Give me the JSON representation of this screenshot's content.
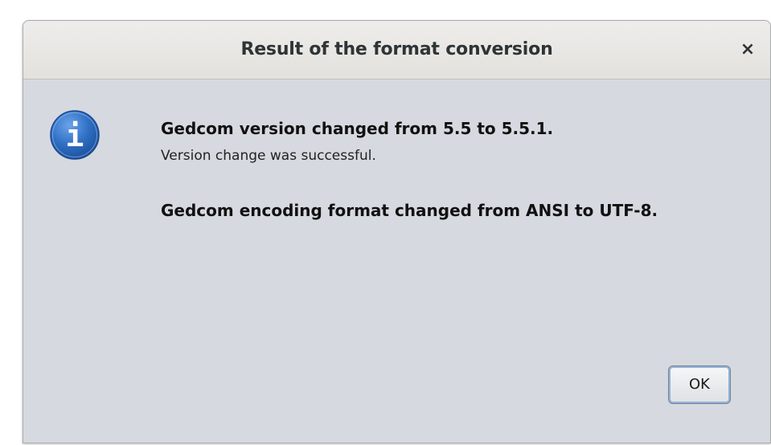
{
  "dialog": {
    "title": "Result of the format conversion",
    "close_glyph": "×",
    "icon": "info-icon",
    "icon_letter": "i",
    "messages": [
      {
        "text": "Gedcom version changed from 5.5 to 5.5.1.",
        "style": "bold"
      },
      {
        "text": "Version change was successful.",
        "style": "normal"
      },
      {
        "text": "Gedcom encoding format changed from ANSI to UTF-8.",
        "style": "bold"
      }
    ],
    "ok_label": "OK"
  },
  "colors": {
    "dialog_background": "#d6d9df",
    "titlebar_background": "#e8e6e2",
    "icon_blue": "#2f6fc4",
    "button_focus_ring": "#8fb4dc"
  }
}
